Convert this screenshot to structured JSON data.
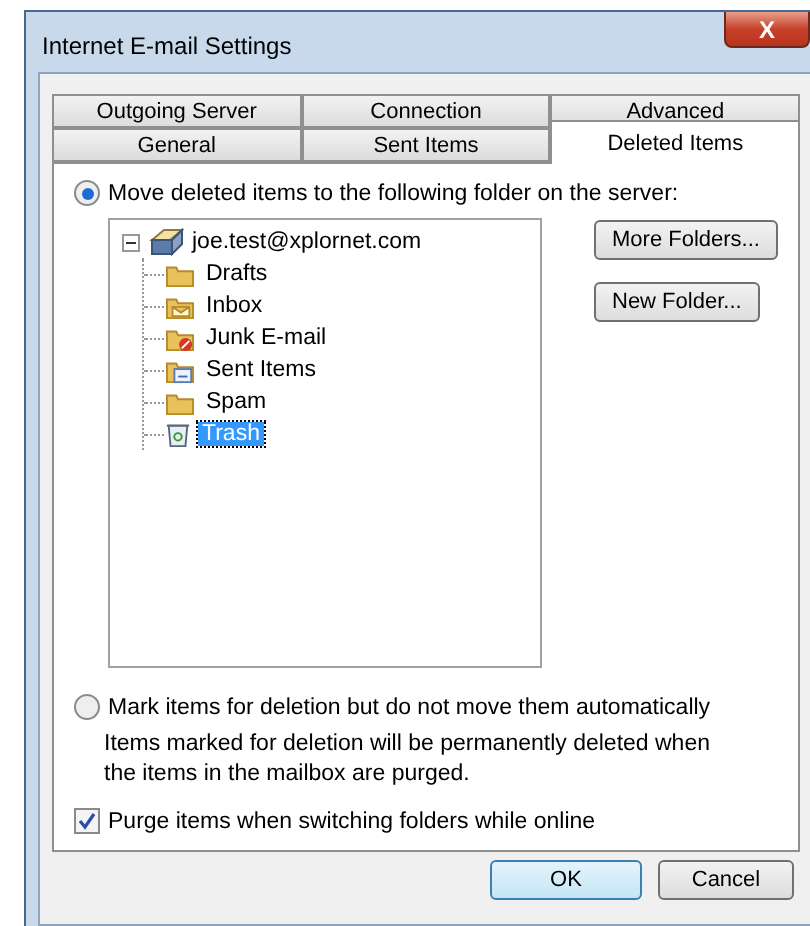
{
  "window": {
    "title": "Internet E-mail Settings",
    "close": "X"
  },
  "tab_rows": [
    [
      {
        "label": "Outgoing Server",
        "selected": false
      },
      {
        "label": "Connection",
        "selected": false
      },
      {
        "label": "Advanced",
        "selected": false
      }
    ],
    [
      {
        "label": "General",
        "selected": false
      },
      {
        "label": "Sent Items",
        "selected": false
      },
      {
        "label": "Deleted Items",
        "selected": true
      }
    ]
  ],
  "move_option": {
    "label": "Move deleted items to the following folder on the server:",
    "selected": true
  },
  "folder_tree": {
    "label": "joe.test@xplornet.com",
    "expanded": true,
    "children": [
      {
        "label": "Drafts",
        "kind": "folder",
        "selected": false
      },
      {
        "label": "Inbox",
        "kind": "inbox",
        "selected": false
      },
      {
        "label": "Junk E-mail",
        "kind": "junk",
        "selected": false
      },
      {
        "label": "Sent Items",
        "kind": "sent",
        "selected": false
      },
      {
        "label": "Spam",
        "kind": "folder",
        "selected": false
      },
      {
        "label": "Trash",
        "kind": "trash",
        "selected": true
      }
    ]
  },
  "folder_buttons": [
    "More Folders...",
    "New Folder..."
  ],
  "mark_option": {
    "label": "Mark items for deletion but do not move them automatically",
    "selected": false
  },
  "mark_note": "Items marked for deletion will be permanently deleted when the items in the mailbox are purged.",
  "purge_option": {
    "label": "Purge items when switching folders while online",
    "checked": true
  },
  "buttons": [
    {
      "label": "OK",
      "default": true
    },
    {
      "label": "Cancel",
      "default": false
    }
  ]
}
